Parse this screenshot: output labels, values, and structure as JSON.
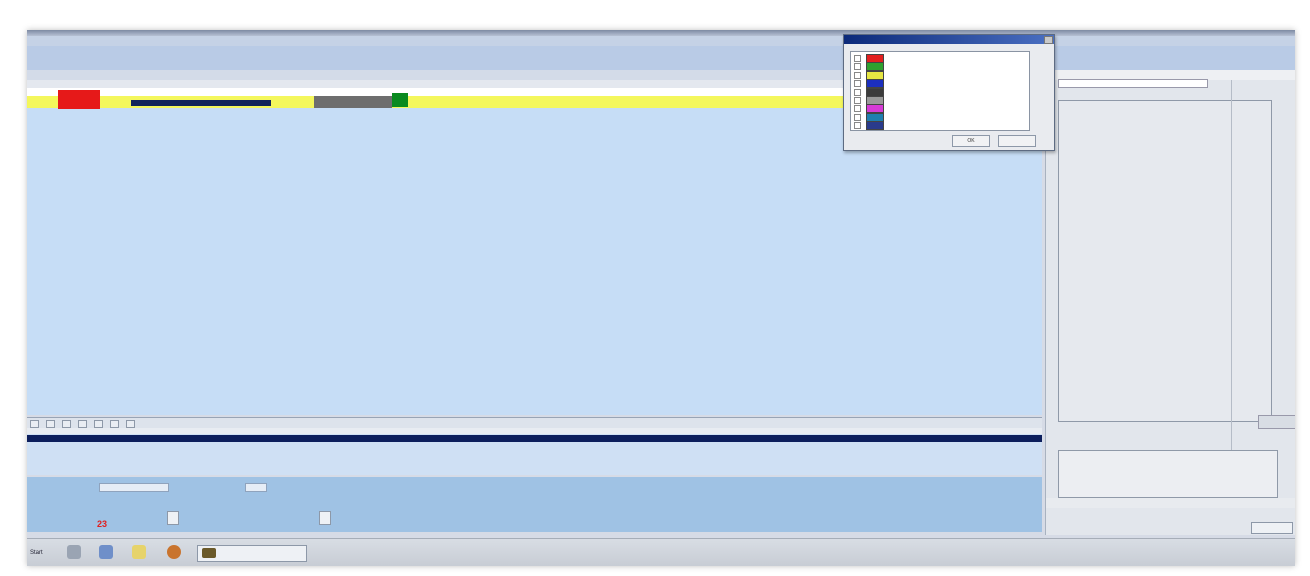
{
  "window": {
    "menu": [
      "",
      "",
      "",
      "",
      "",
      "",
      ""
    ],
    "tab_label": ""
  },
  "grid": {
    "columns": [
      "",
      "",
      "",
      "",
      "",
      "",
      "",
      "",
      "",
      "",
      "",
      "",
      "",
      "",
      "",
      "",
      ""
    ],
    "row1": {
      "cells": [
        "",
        "",
        ""
      ]
    },
    "row2": {
      "cells": [
        "",
        "",
        "",
        ""
      ]
    },
    "red_cell": "",
    "navy_cell": "",
    "gray_cell": [
      "",
      ""
    ]
  },
  "lower_list": {
    "header": "",
    "selected_row": {
      "col1": "",
      "col2": ""
    },
    "row": {
      "col1": "",
      "col2": ""
    }
  },
  "form": {
    "labels": [
      "",
      "",
      "",
      "",
      "",
      "",
      ""
    ],
    "values": [
      "",
      "",
      "",
      ""
    ],
    "highlight_value": "23"
  },
  "right_panel": {
    "header": [
      "",
      ""
    ],
    "box_headers": [
      "",
      "",
      "",
      ""
    ],
    "footer": [
      "",
      "",
      "",
      ""
    ]
  },
  "dialog": {
    "title": "",
    "items": [
      {
        "label": "",
        "color": "#e31f1f"
      },
      {
        "label": "",
        "color": "#2fa12f"
      },
      {
        "label": "",
        "color": "#e6e642"
      },
      {
        "label": "",
        "color": "#1c2fbf"
      },
      {
        "label": "",
        "color": "#3b3b3b"
      },
      {
        "label": "",
        "color": "#9a9a9a"
      },
      {
        "label": "",
        "color": "#d63bd6"
      },
      {
        "label": "",
        "color": "#1f7fb0"
      },
      {
        "label": "",
        "color": "#2a3b8c"
      }
    ],
    "ok_label": "OK",
    "cancel_label": ""
  },
  "taskbar": {
    "start_label": "Start",
    "window_button": "",
    "tray": [
      "",
      ""
    ]
  }
}
